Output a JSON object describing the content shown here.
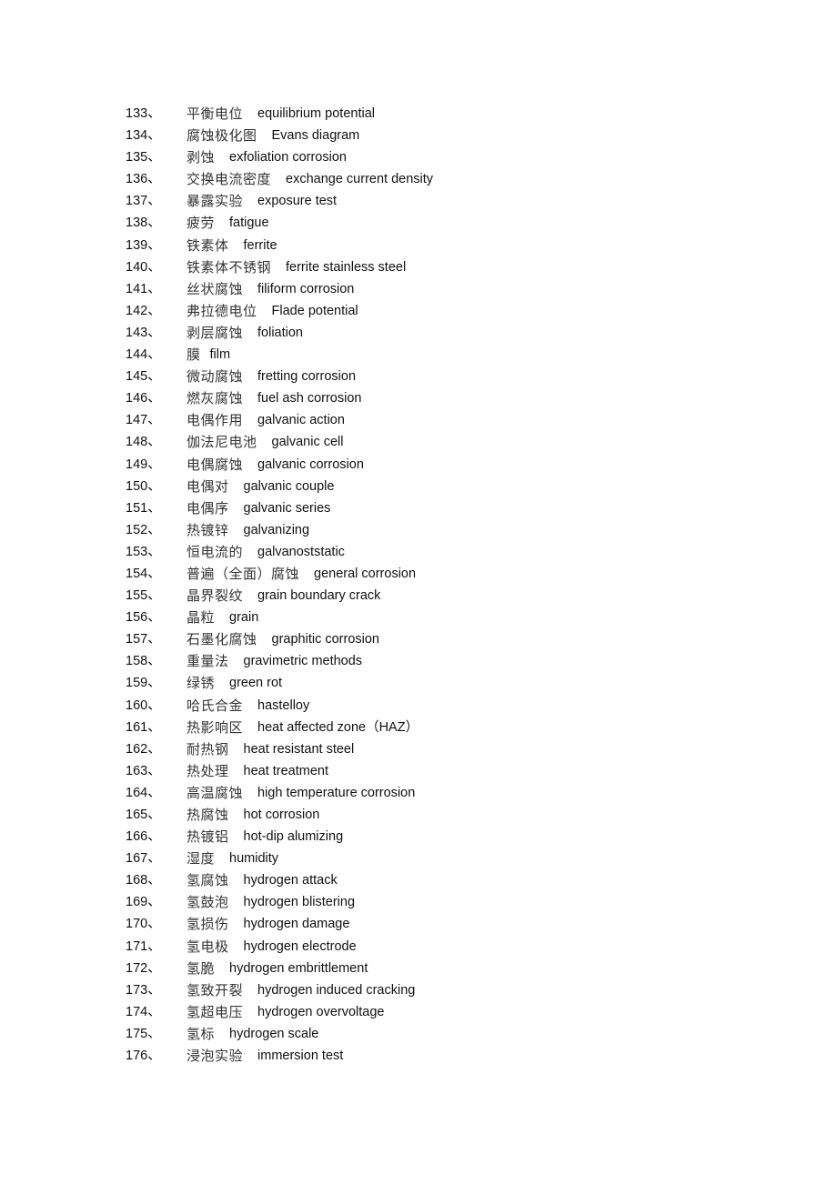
{
  "document": {
    "entries": [
      {
        "num": "133、",
        "zh": "平衡电位",
        "en": "equilibrium potential"
      },
      {
        "num": "134、",
        "zh": "腐蚀极化图",
        "en": "Evans diagram"
      },
      {
        "num": "135、",
        "zh": "剥蚀",
        "en": "exfoliation corrosion"
      },
      {
        "num": "136、",
        "zh": "交换电流密度",
        "en": "exchange current density"
      },
      {
        "num": "137、",
        "zh": "暴露实验",
        "en": "exposure test"
      },
      {
        "num": "138、",
        "zh": "疲劳",
        "en": "fatigue"
      },
      {
        "num": "139、",
        "zh": "铁素体",
        "en": "ferrite"
      },
      {
        "num": "140、",
        "zh": "铁素体不锈钢",
        "en": "ferrite stainless steel"
      },
      {
        "num": "141、",
        "zh": "丝状腐蚀",
        "en": "filiform corrosion"
      },
      {
        "num": "142、",
        "zh": "弗拉德电位",
        "en": "Flade potential"
      },
      {
        "num": "143、",
        "zh": "剥层腐蚀",
        "en": "foliation"
      },
      {
        "num": "144、",
        "zh": "膜",
        "en": "film",
        "tight": true
      },
      {
        "num": "145、",
        "zh": "微动腐蚀",
        "en": "fretting corrosion"
      },
      {
        "num": "146、",
        "zh": "燃灰腐蚀",
        "en": "fuel ash corrosion"
      },
      {
        "num": "147、",
        "zh": "电偶作用",
        "en": "galvanic action"
      },
      {
        "num": "148、",
        "zh": "伽法尼电池",
        "en": "galvanic cell"
      },
      {
        "num": "149、",
        "zh": "电偶腐蚀",
        "en": "galvanic corrosion"
      },
      {
        "num": "150、",
        "zh": "电偶对",
        "en": "galvanic couple"
      },
      {
        "num": "151、",
        "zh": "电偶序",
        "en": "galvanic series"
      },
      {
        "num": "152、",
        "zh": "热镀锌",
        "en": "galvanizing"
      },
      {
        "num": "153、",
        "zh": "恒电流的",
        "en": "galvanoststatic"
      },
      {
        "num": "154、",
        "zh": "普遍（全面）腐蚀",
        "en": "general corrosion"
      },
      {
        "num": "155、",
        "zh": "晶界裂纹",
        "en": "grain boundary crack"
      },
      {
        "num": "156、",
        "zh": "晶粒",
        "en": "grain"
      },
      {
        "num": "157、",
        "zh": "石墨化腐蚀",
        "en": "graphitic corrosion"
      },
      {
        "num": "158、",
        "zh": "重量法",
        "en": "gravimetric methods"
      },
      {
        "num": "159、",
        "zh": "绿锈",
        "en": "green rot"
      },
      {
        "num": "160、",
        "zh": "哈氏合金",
        "en": "hastelloy"
      },
      {
        "num": "161、",
        "zh": "热影响区",
        "en": "heat affected zone（HAZ）"
      },
      {
        "num": "162、",
        "zh": "耐热钢",
        "en": "heat resistant steel"
      },
      {
        "num": "163、",
        "zh": "热处理",
        "en": "heat treatment"
      },
      {
        "num": "164、",
        "zh": "高温腐蚀",
        "en": "high temperature corrosion"
      },
      {
        "num": "165、",
        "zh": "热腐蚀",
        "en": "hot corrosion"
      },
      {
        "num": "166、",
        "zh": "热镀铝",
        "en": "hot-dip alumizing"
      },
      {
        "num": "167、",
        "zh": "湿度",
        "en": "humidity"
      },
      {
        "num": "168、",
        "zh": "氢腐蚀",
        "en": "hydrogen attack"
      },
      {
        "num": "169、",
        "zh": "氢鼓泡",
        "en": "hydrogen blistering"
      },
      {
        "num": "170、",
        "zh": "氢损伤",
        "en": "hydrogen damage"
      },
      {
        "num": "171、",
        "zh": "氢电极",
        "en": "hydrogen electrode"
      },
      {
        "num": "172、",
        "zh": "氢脆",
        "en": "hydrogen embrittlement"
      },
      {
        "num": "173、",
        "zh": "氢致开裂",
        "en": "hydrogen induced cracking"
      },
      {
        "num": "174、",
        "zh": "氢超电压",
        "en": "hydrogen overvoltage"
      },
      {
        "num": "175、",
        "zh": "氢标",
        "en": "hydrogen scale"
      },
      {
        "num": "176、",
        "zh": "浸泡实验",
        "en": "immersion test"
      }
    ]
  }
}
